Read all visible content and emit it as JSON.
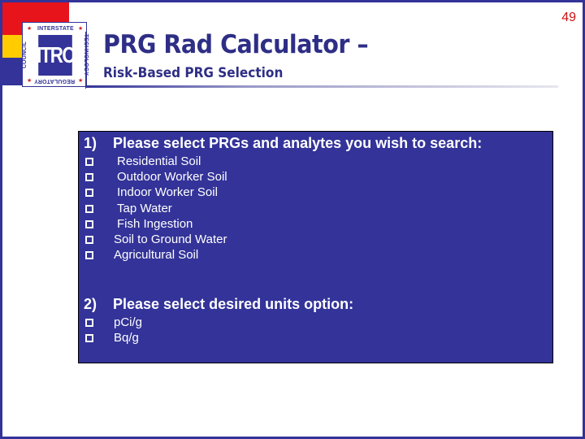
{
  "header": {
    "logo": {
      "center_text": "ITRC",
      "top_text": "INTERSTATE",
      "right_text": "TECHNOLOGY",
      "bottom_text": "REGULATORY",
      "left_text": "COUNCIL",
      "colors": {
        "red": "#e8141c",
        "yellow": "#ffcc00",
        "blue": "#333399"
      }
    },
    "title": "PRG Rad Calculator –",
    "subtitle": "Risk-Based PRG Selection",
    "page_number": "49"
  },
  "panel": {
    "question1": {
      "number": "1)",
      "text": "Please select PRGs and analytes you wish to search:",
      "options": [
        {
          "label": "Residential Soil",
          "checked": false
        },
        {
          "label": "Outdoor Worker Soil",
          "checked": false
        },
        {
          "label": "Indoor Worker Soil",
          "checked": false
        },
        {
          "label": "Tap Water",
          "checked": false
        },
        {
          "label": "Fish Ingestion",
          "checked": false
        },
        {
          "label": "Soil to Ground Water",
          "checked": false
        },
        {
          "label": "Agricultural Soil",
          "checked": false
        }
      ]
    },
    "question2": {
      "number": "2)",
      "text": "Please select desired units option:",
      "options": [
        {
          "label": "pCi/g",
          "checked": false
        },
        {
          "label": "Bq/g",
          "checked": false
        }
      ]
    }
  },
  "colors": {
    "frame": "#333399",
    "panel_bg": "#333399",
    "title": "#2e2e86",
    "page_number": "#cc1111"
  }
}
